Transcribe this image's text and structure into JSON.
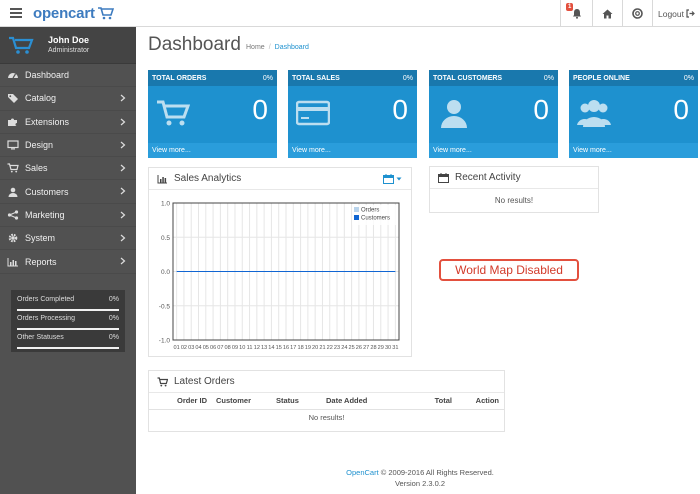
{
  "header": {
    "logo": "opencart",
    "notification_count": "1",
    "logout_label": "Logout"
  },
  "profile": {
    "name": "John Doe",
    "role": "Administrator"
  },
  "nav": [
    {
      "label": "Dashboard",
      "icon": "dashboard-icon",
      "has_children": false
    },
    {
      "label": "Catalog",
      "icon": "tag-icon",
      "has_children": true
    },
    {
      "label": "Extensions",
      "icon": "puzzle-icon",
      "has_children": true
    },
    {
      "label": "Design",
      "icon": "monitor-icon",
      "has_children": true
    },
    {
      "label": "Sales",
      "icon": "cart-icon",
      "has_children": true
    },
    {
      "label": "Customers",
      "icon": "user-icon",
      "has_children": true
    },
    {
      "label": "Marketing",
      "icon": "share-icon",
      "has_children": true
    },
    {
      "label": "System",
      "icon": "cog-icon",
      "has_children": true
    },
    {
      "label": "Reports",
      "icon": "bar-chart-icon",
      "has_children": true
    }
  ],
  "sidebar_stats": [
    {
      "label": "Orders Completed",
      "value": "0%"
    },
    {
      "label": "Orders Processing",
      "value": "0%"
    },
    {
      "label": "Other Statuses",
      "value": "0%"
    }
  ],
  "page": {
    "title": "Dashboard",
    "breadcrumb": [
      "Home",
      "Dashboard"
    ]
  },
  "tiles": [
    {
      "title": "TOTAL ORDERS",
      "percent": "0%",
      "value": "0",
      "link": "View more...",
      "icon": "shopping-cart-icon"
    },
    {
      "title": "TOTAL SALES",
      "percent": "0%",
      "value": "0",
      "link": "View more...",
      "icon": "credit-card-icon"
    },
    {
      "title": "TOTAL CUSTOMERS",
      "percent": "0%",
      "value": "0",
      "link": "View more...",
      "icon": "user-icon"
    },
    {
      "title": "PEOPLE ONLINE",
      "percent": "0%",
      "value": "0",
      "link": "View more...",
      "icon": "users-icon"
    }
  ],
  "sales_analytics": {
    "title": "Sales Analytics",
    "icon": "bar-chart-icon",
    "range_icon": "calendar-icon"
  },
  "chart_data": {
    "type": "line",
    "x": [
      "01",
      "02",
      "03",
      "04",
      "05",
      "06",
      "07",
      "08",
      "09",
      "10",
      "11",
      "12",
      "13",
      "14",
      "15",
      "16",
      "17",
      "18",
      "19",
      "20",
      "21",
      "22",
      "23",
      "24",
      "25",
      "26",
      "27",
      "28",
      "29",
      "30",
      "31"
    ],
    "series": [
      {
        "name": "Orders",
        "values": [
          0,
          0,
          0,
          0,
          0,
          0,
          0,
          0,
          0,
          0,
          0,
          0,
          0,
          0,
          0,
          0,
          0,
          0,
          0,
          0,
          0,
          0,
          0,
          0,
          0,
          0,
          0,
          0,
          0,
          0,
          0
        ],
        "color": "#b9d4ec"
      },
      {
        "name": "Customers",
        "values": [
          0,
          0,
          0,
          0,
          0,
          0,
          0,
          0,
          0,
          0,
          0,
          0,
          0,
          0,
          0,
          0,
          0,
          0,
          0,
          0,
          0,
          0,
          0,
          0,
          0,
          0,
          0,
          0,
          0,
          0,
          0
        ],
        "color": "#1065d2"
      }
    ],
    "ylim": [
      -1.0,
      1.0
    ],
    "yticks": [
      "1.0",
      "0.5",
      "0.0",
      "-0.5",
      "-1.0"
    ],
    "grid": true,
    "legend": "top-right"
  },
  "recent_activity": {
    "title": "Recent Activity",
    "empty": "No results!"
  },
  "world_map": {
    "message": "World Map Disabled"
  },
  "latest_orders": {
    "title": "Latest Orders",
    "columns": [
      "Order ID",
      "Customer",
      "Status",
      "Date Added",
      "Total",
      "Action"
    ],
    "empty": "No results!"
  },
  "footer": {
    "link": "OpenCart",
    "copyright": "© 2009-2016 All Rights Reserved.",
    "version": "Version 2.3.0.2"
  },
  "colors": {
    "primary": "#1e91cf",
    "sidebar": "#515151",
    "alert": "#e3503e"
  }
}
